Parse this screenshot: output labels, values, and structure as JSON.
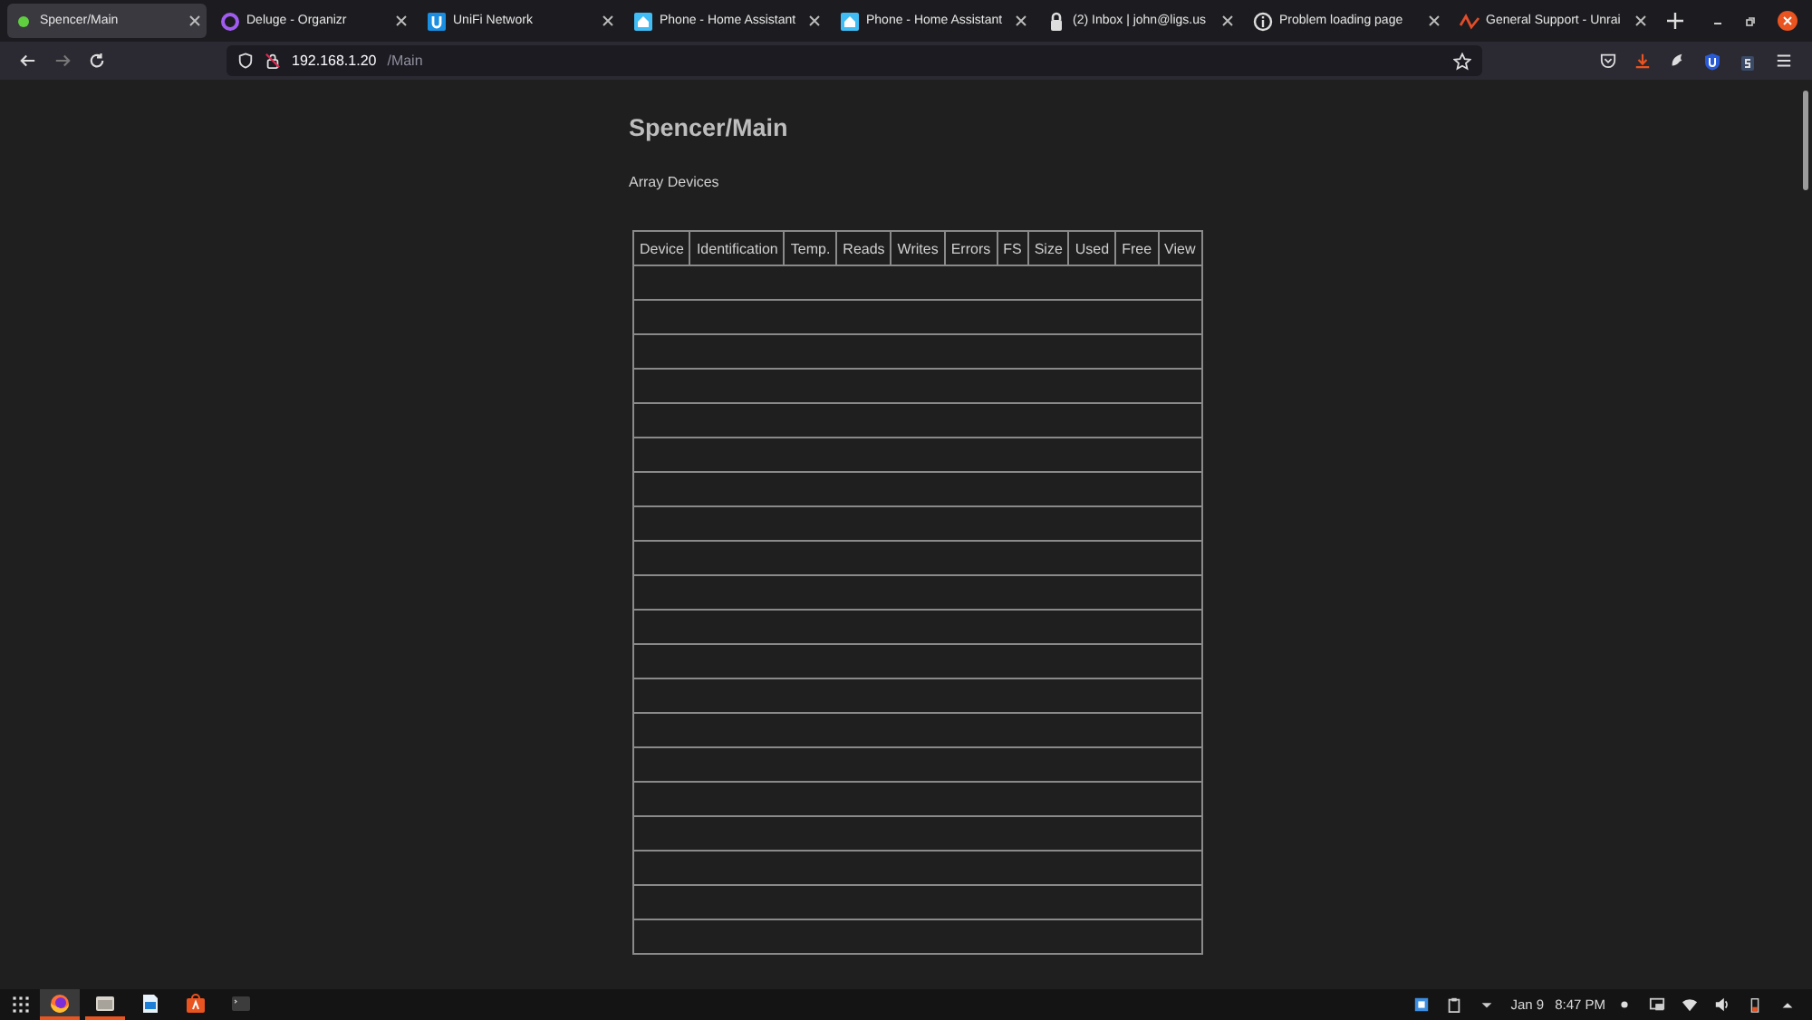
{
  "tabs": [
    {
      "label": "Spencer/Main",
      "kind": "dot",
      "selected": true
    },
    {
      "label": "Deluge - Organizr",
      "kind": "ring",
      "selected": false
    },
    {
      "label": "UniFi Network",
      "kind": "unifi",
      "selected": false
    },
    {
      "label": "Phone - Home Assistant",
      "kind": "house",
      "selected": false
    },
    {
      "label": "Phone - Home Assistant",
      "kind": "house",
      "selected": false
    },
    {
      "label": "(2) Inbox | john@ligs.us",
      "kind": "lock",
      "selected": false
    },
    {
      "label": "Problem loading page",
      "kind": "info",
      "selected": false
    },
    {
      "label": "General Support - Unrai",
      "kind": "wave",
      "selected": false
    }
  ],
  "address_bar": {
    "host": "192.168.1.20",
    "path": "/Main"
  },
  "page": {
    "title": "Spencer/Main",
    "section": "Array Devices",
    "table": {
      "columns": [
        "Device",
        "Identification",
        "Temp.",
        "Reads",
        "Writes",
        "Errors",
        "FS",
        "Size",
        "Used",
        "Free",
        "View"
      ],
      "rows": [
        {
          "kind": "empty"
        },
        {
          "kind": "empty"
        },
        {
          "kind": "empty"
        },
        {
          "kind": "empty"
        },
        {
          "kind": "empty"
        },
        {
          "kind": "empty"
        },
        {
          "kind": "empty"
        },
        {
          "kind": "empty"
        },
        {
          "kind": "empty"
        },
        {
          "kind": "empty"
        },
        {
          "kind": "empty"
        },
        {
          "kind": "empty"
        },
        {
          "kind": "empty"
        },
        {
          "kind": "empty"
        },
        {
          "kind": "empty"
        },
        {
          "kind": "empty"
        },
        {
          "kind": "empty"
        },
        {
          "kind": "empty"
        },
        {
          "kind": "empty"
        },
        {
          "kind": "empty"
        }
      ]
    }
  },
  "taskbar": {
    "apps": [
      {
        "kind": "firefox",
        "active": true,
        "running": true
      },
      {
        "kind": "files",
        "active": false,
        "running": true
      },
      {
        "kind": "writer",
        "active": false,
        "running": false
      },
      {
        "kind": "store",
        "active": false,
        "running": false
      },
      {
        "kind": "terminal",
        "active": false,
        "running": false
      }
    ],
    "date": "Jan 9",
    "time": "8:47 PM"
  }
}
